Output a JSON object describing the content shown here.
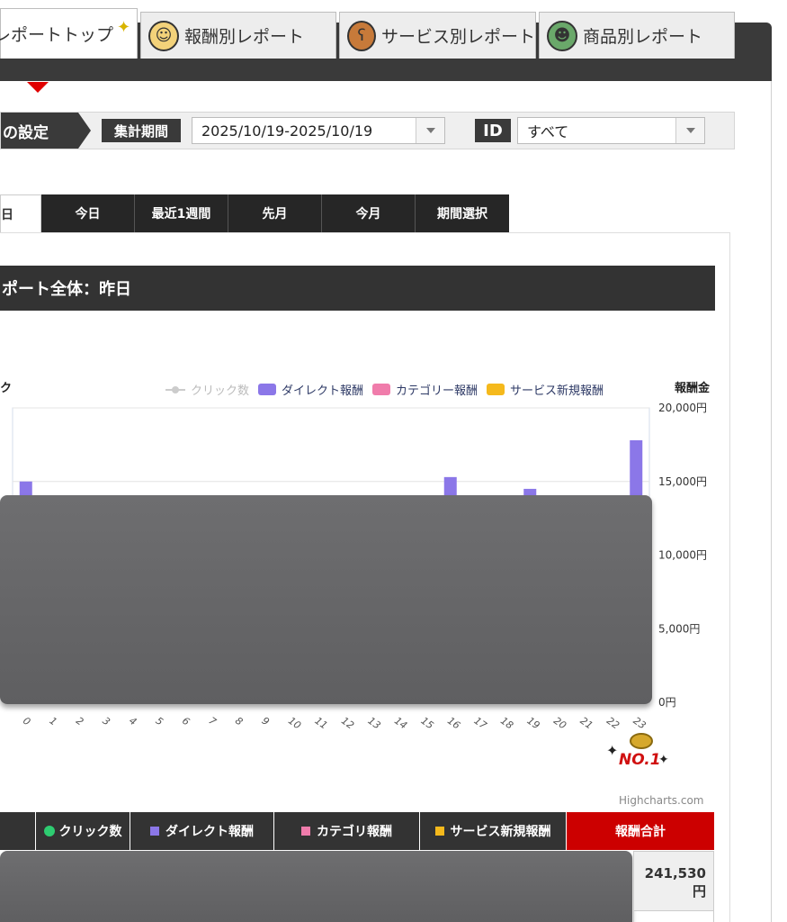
{
  "top_tabs": [
    {
      "label": "レポートトップ",
      "icon": "sparkle-icon"
    },
    {
      "label": "報酬別レポート",
      "icon": "girl-character-icon"
    },
    {
      "label": "サービス別レポート",
      "icon": "bear-character-icon"
    },
    {
      "label": "商品別レポート",
      "icon": "kappa-character-icon"
    }
  ],
  "settings": {
    "head_label": "の設定",
    "period_label": "集計期間",
    "period_value": "2025/10/19-2025/10/19",
    "id_label": "ID",
    "id_value": "すべて"
  },
  "period_tabs": [
    "日",
    "今日",
    "最近1週間",
    "先月",
    "今月",
    "期間選択"
  ],
  "report_title": "ポート全体：昨日",
  "chart_data": {
    "type": "bar",
    "left_axis_title": "ク",
    "right_axis_title": "報酬金",
    "legend": [
      {
        "name": "クリック数",
        "color": "#cccccc",
        "disabled": true
      },
      {
        "name": "ダイレクト報酬",
        "color": "#8b77e8"
      },
      {
        "name": "カテゴリー報酬",
        "color": "#f07cab"
      },
      {
        "name": "サービス新規報酬",
        "color": "#f5b91c"
      }
    ],
    "categories": [
      "0",
      "1",
      "2",
      "3",
      "4",
      "5",
      "6",
      "7",
      "8",
      "9",
      "10",
      "11",
      "12",
      "13",
      "14",
      "15",
      "16",
      "17",
      "18",
      "19",
      "20",
      "21",
      "22",
      "23"
    ],
    "series": [
      {
        "name": "ダイレクト報酬",
        "values": [
          15000,
          null,
          null,
          null,
          null,
          null,
          null,
          null,
          null,
          null,
          null,
          null,
          null,
          null,
          null,
          null,
          15300,
          null,
          null,
          14500,
          null,
          null,
          null,
          17800
        ]
      }
    ],
    "y_ticks": [
      "0円",
      "5,000円",
      "10,000円",
      "15,000円",
      "20,000円"
    ],
    "ylim": [
      0,
      20000
    ]
  },
  "credit": "Highcharts.com",
  "table_headers": [
    {
      "label": "クリック数",
      "marker": "dot",
      "color": "#2ecc71"
    },
    {
      "label": "ダイレクト報酬",
      "marker": "square",
      "color": "#8b77e8"
    },
    {
      "label": "カテゴリ報酬",
      "marker": "square",
      "color": "#f07cab"
    },
    {
      "label": "サービス新規報酬",
      "marker": "square",
      "color": "#f5b91c"
    },
    {
      "label": "報酬合計",
      "marker": "none",
      "color": "#cc0000"
    }
  ],
  "total_value": "241,530",
  "total_unit": "円",
  "badge_text": "NO.1"
}
